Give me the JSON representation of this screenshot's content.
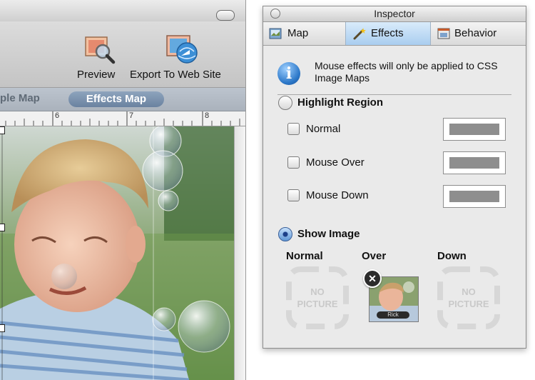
{
  "main_window": {
    "toolbar": {
      "preview_label": "Preview",
      "export_label": "Export To Web Site"
    },
    "tabs": {
      "left_partial_label": "ple Map",
      "effects_map_label": "Effects Map"
    },
    "ruler": {
      "marks": [
        "6",
        "7",
        "8"
      ]
    }
  },
  "inspector": {
    "title": "Inspector",
    "tabs": {
      "map": "Map",
      "effects": "Effects",
      "behavior": "Behavior"
    },
    "active_tab": "Effects",
    "info_text": "Mouse effects will only be applied to CSS Image Maps",
    "highlight_region": {
      "label": "Highlight Region",
      "selected": false,
      "options": [
        {
          "label": "Normal",
          "checked": false,
          "color": "#8e8e8e"
        },
        {
          "label": "Mouse Over",
          "checked": false,
          "color": "#8e8e8e"
        },
        {
          "label": "Mouse Down",
          "checked": false,
          "color": "#8e8e8e"
        }
      ]
    },
    "show_image": {
      "label": "Show Image",
      "selected": true,
      "columns": {
        "normal": "Normal",
        "over": "Over",
        "down": "Down"
      },
      "placeholder_line1": "NO",
      "placeholder_line2": "PICTURE",
      "over_image_caption": "Rick",
      "remove_symbol": "✕"
    }
  },
  "colors": {
    "accent_blue": "#2b77c8",
    "swatch_gray": "#8e8e8e",
    "tab_selected": "#a9cdef"
  },
  "icons": [
    "pill-toolbar-icon",
    "preview-magnifier-icon",
    "export-globe-icon",
    "map-icon",
    "effects-wand-icon",
    "behavior-window-icon",
    "info-icon",
    "remove-x-icon"
  ]
}
